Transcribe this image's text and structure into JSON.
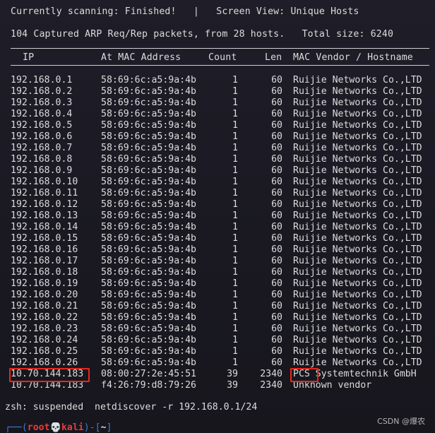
{
  "status": {
    "scanning_label": "Currently scanning:",
    "scanning_value": "Finished!",
    "separator": "|",
    "view_label": "Screen View:",
    "view_value": "Unique Hosts"
  },
  "summary": {
    "text": "104 Captured ARP Req/Rep packets, from 28 hosts.",
    "size_label": "Total size:",
    "size_value": "6240"
  },
  "table": {
    "headers": {
      "ip": "IP",
      "mac": "At MAC Address",
      "count": "Count",
      "len": "Len",
      "vendor": "MAC Vendor / Hostname"
    },
    "rows": [
      {
        "ip": "192.168.0.1",
        "mac": "58:69:6c:a5:9a:4b",
        "count": "1",
        "len": "60",
        "vendor": "Ruijie Networks Co.,LTD"
      },
      {
        "ip": "192.168.0.2",
        "mac": "58:69:6c:a5:9a:4b",
        "count": "1",
        "len": "60",
        "vendor": "Ruijie Networks Co.,LTD"
      },
      {
        "ip": "192.168.0.3",
        "mac": "58:69:6c:a5:9a:4b",
        "count": "1",
        "len": "60",
        "vendor": "Ruijie Networks Co.,LTD"
      },
      {
        "ip": "192.168.0.4",
        "mac": "58:69:6c:a5:9a:4b",
        "count": "1",
        "len": "60",
        "vendor": "Ruijie Networks Co.,LTD"
      },
      {
        "ip": "192.168.0.5",
        "mac": "58:69:6c:a5:9a:4b",
        "count": "1",
        "len": "60",
        "vendor": "Ruijie Networks Co.,LTD"
      },
      {
        "ip": "192.168.0.6",
        "mac": "58:69:6c:a5:9a:4b",
        "count": "1",
        "len": "60",
        "vendor": "Ruijie Networks Co.,LTD"
      },
      {
        "ip": "192.168.0.7",
        "mac": "58:69:6c:a5:9a:4b",
        "count": "1",
        "len": "60",
        "vendor": "Ruijie Networks Co.,LTD"
      },
      {
        "ip": "192.168.0.8",
        "mac": "58:69:6c:a5:9a:4b",
        "count": "1",
        "len": "60",
        "vendor": "Ruijie Networks Co.,LTD"
      },
      {
        "ip": "192.168.0.9",
        "mac": "58:69:6c:a5:9a:4b",
        "count": "1",
        "len": "60",
        "vendor": "Ruijie Networks Co.,LTD"
      },
      {
        "ip": "192.168.0.10",
        "mac": "58:69:6c:a5:9a:4b",
        "count": "1",
        "len": "60",
        "vendor": "Ruijie Networks Co.,LTD"
      },
      {
        "ip": "192.168.0.11",
        "mac": "58:69:6c:a5:9a:4b",
        "count": "1",
        "len": "60",
        "vendor": "Ruijie Networks Co.,LTD"
      },
      {
        "ip": "192.168.0.12",
        "mac": "58:69:6c:a5:9a:4b",
        "count": "1",
        "len": "60",
        "vendor": "Ruijie Networks Co.,LTD"
      },
      {
        "ip": "192.168.0.13",
        "mac": "58:69:6c:a5:9a:4b",
        "count": "1",
        "len": "60",
        "vendor": "Ruijie Networks Co.,LTD"
      },
      {
        "ip": "192.168.0.14",
        "mac": "58:69:6c:a5:9a:4b",
        "count": "1",
        "len": "60",
        "vendor": "Ruijie Networks Co.,LTD"
      },
      {
        "ip": "192.168.0.15",
        "mac": "58:69:6c:a5:9a:4b",
        "count": "1",
        "len": "60",
        "vendor": "Ruijie Networks Co.,LTD"
      },
      {
        "ip": "192.168.0.16",
        "mac": "58:69:6c:a5:9a:4b",
        "count": "1",
        "len": "60",
        "vendor": "Ruijie Networks Co.,LTD"
      },
      {
        "ip": "192.168.0.17",
        "mac": "58:69:6c:a5:9a:4b",
        "count": "1",
        "len": "60",
        "vendor": "Ruijie Networks Co.,LTD"
      },
      {
        "ip": "192.168.0.18",
        "mac": "58:69:6c:a5:9a:4b",
        "count": "1",
        "len": "60",
        "vendor": "Ruijie Networks Co.,LTD"
      },
      {
        "ip": "192.168.0.19",
        "mac": "58:69:6c:a5:9a:4b",
        "count": "1",
        "len": "60",
        "vendor": "Ruijie Networks Co.,LTD"
      },
      {
        "ip": "192.168.0.20",
        "mac": "58:69:6c:a5:9a:4b",
        "count": "1",
        "len": "60",
        "vendor": "Ruijie Networks Co.,LTD"
      },
      {
        "ip": "192.168.0.21",
        "mac": "58:69:6c:a5:9a:4b",
        "count": "1",
        "len": "60",
        "vendor": "Ruijie Networks Co.,LTD"
      },
      {
        "ip": "192.168.0.22",
        "mac": "58:69:6c:a5:9a:4b",
        "count": "1",
        "len": "60",
        "vendor": "Ruijie Networks Co.,LTD"
      },
      {
        "ip": "192.168.0.23",
        "mac": "58:69:6c:a5:9a:4b",
        "count": "1",
        "len": "60",
        "vendor": "Ruijie Networks Co.,LTD"
      },
      {
        "ip": "192.168.0.24",
        "mac": "58:69:6c:a5:9a:4b",
        "count": "1",
        "len": "60",
        "vendor": "Ruijie Networks Co.,LTD"
      },
      {
        "ip": "192.168.0.25",
        "mac": "58:69:6c:a5:9a:4b",
        "count": "1",
        "len": "60",
        "vendor": "Ruijie Networks Co.,LTD"
      },
      {
        "ip": "192.168.0.26",
        "mac": "58:69:6c:a5:9a:4b",
        "count": "1",
        "len": "60",
        "vendor": "Ruijie Networks Co.,LTD"
      },
      {
        "ip": "10.70.144.183",
        "mac": "08:00:27:2e:45:51",
        "count": "39",
        "len": "2340",
        "vendor": "PCS Systemtechnik GmbH"
      },
      {
        "ip": "10.70.144.183",
        "mac": "f4:26:79:d8:79:26",
        "count": "39",
        "len": "2340",
        "vendor": "Unknown vendor"
      }
    ]
  },
  "shell": {
    "suspended_text": "zsh: suspended  netdiscover -r 192.168.0.1/24",
    "prompt_prefix": "┌──(",
    "prompt_user": "root💀kali",
    "prompt_mid": ")-[",
    "prompt_dir": "~",
    "prompt_suffix": "]"
  },
  "watermark": "CSDN @爆农",
  "colors": {
    "background": "#1c1a24",
    "text": "#dcdcdc",
    "highlight": "#e8271c",
    "prompt_root": "#e33c3c",
    "prompt_frame": "#3b7dd8"
  }
}
